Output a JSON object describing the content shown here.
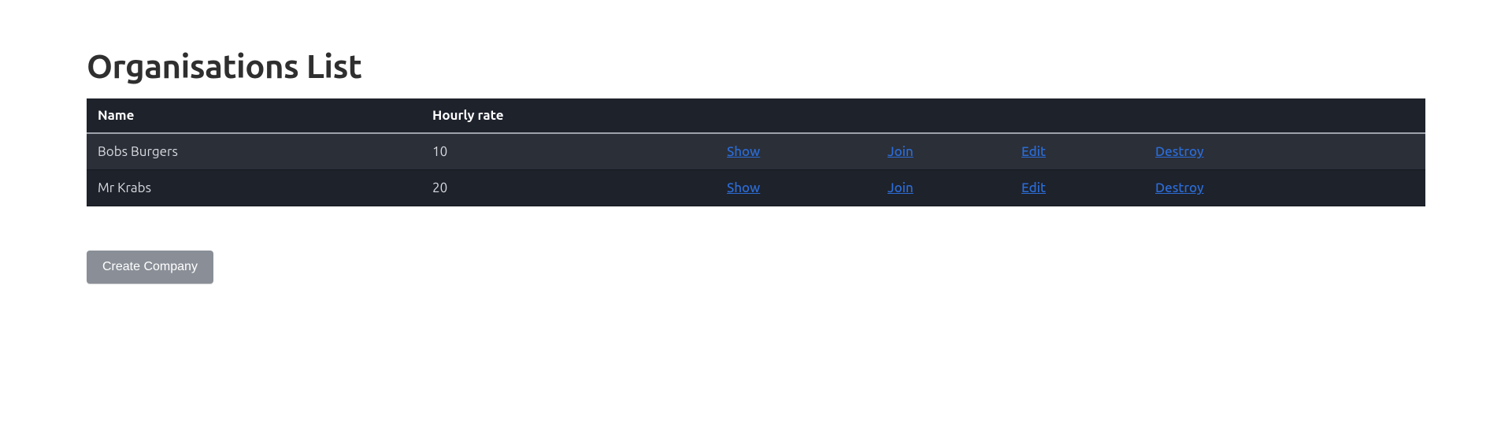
{
  "page": {
    "title": "Organisations List"
  },
  "table": {
    "columns": {
      "name": "Name",
      "hourly_rate": "Hourly rate",
      "show": "",
      "join": "",
      "edit": "",
      "destroy": ""
    },
    "action_labels": {
      "show": "Show",
      "join": "Join",
      "edit": "Edit",
      "destroy": "Destroy"
    },
    "rows": [
      {
        "name": "Bobs Burgers",
        "hourly_rate": "10"
      },
      {
        "name": "Mr Krabs",
        "hourly_rate": "20"
      }
    ]
  },
  "buttons": {
    "create_company": "Create Company"
  }
}
